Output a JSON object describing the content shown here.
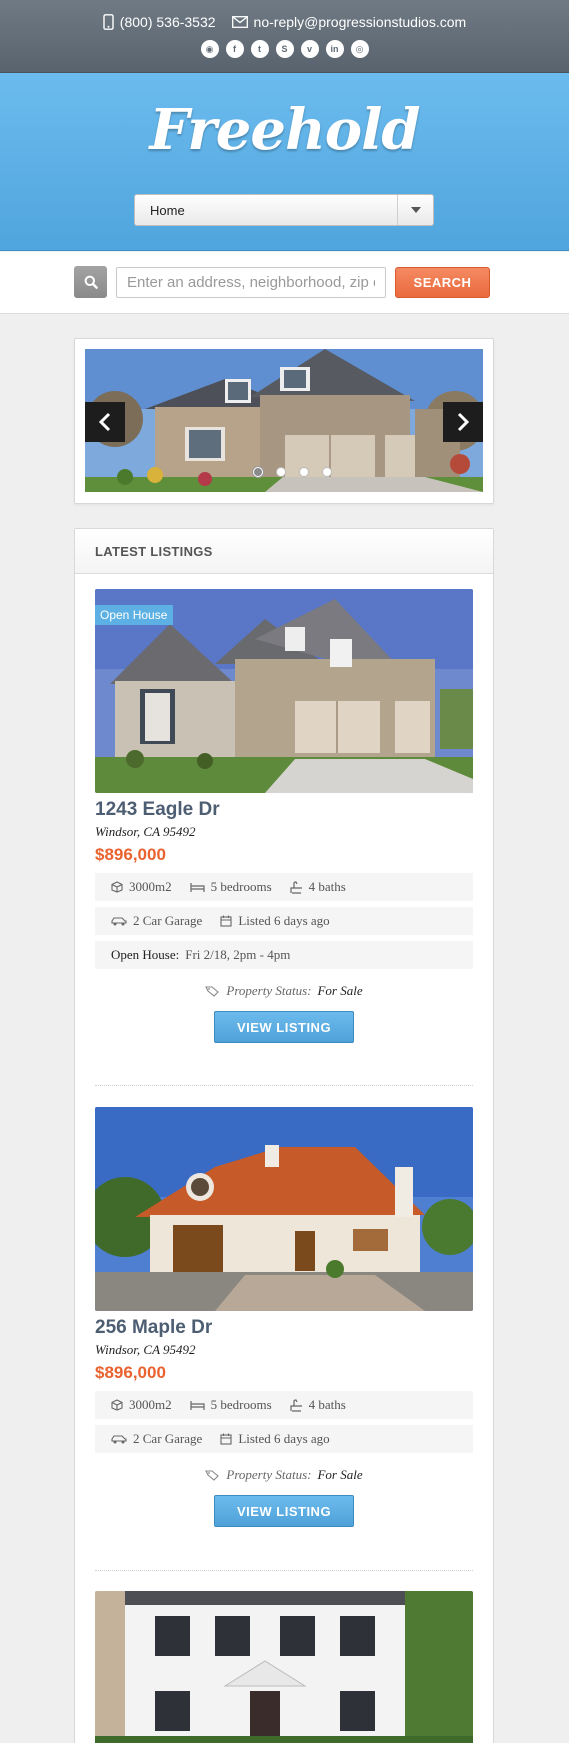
{
  "topbar": {
    "phone": "(800) 536-3532",
    "email": "no-reply@progressionstudios.com",
    "social": [
      {
        "icon": "rss-icon",
        "glyph": "◉"
      },
      {
        "icon": "facebook-icon",
        "glyph": "f"
      },
      {
        "icon": "twitter-icon",
        "glyph": "t"
      },
      {
        "icon": "skype-icon",
        "glyph": "S"
      },
      {
        "icon": "vimeo-icon",
        "glyph": "v"
      },
      {
        "icon": "linkedin-icon",
        "glyph": "in"
      },
      {
        "icon": "dribbble-icon",
        "glyph": "◎"
      }
    ]
  },
  "header": {
    "logo": "Freehold",
    "nav_selected": "Home"
  },
  "search": {
    "placeholder": "Enter an address, neighborhood, zip or",
    "button": "SEARCH"
  },
  "slider": {
    "slides": 4,
    "active_slide": 1
  },
  "listings_section": {
    "title": "LATEST LISTINGS",
    "items": [
      {
        "badge": "Open House",
        "title": "1243 Eagle Dr",
        "city": "Windsor, CA 95492",
        "price": "$896,000",
        "area": "3000m2",
        "bedrooms": "5 bedrooms",
        "baths": "4 baths",
        "garage": "2 Car Garage",
        "listed": "Listed 6 days ago",
        "open_house_label": "Open House:",
        "open_house_time": "Fri 2/18, 2pm - 4pm",
        "status_label": "Property Status:",
        "status_value": "For Sale",
        "button": "VIEW LISTING"
      },
      {
        "title": "256 Maple Dr",
        "city": "Windsor, CA 95492",
        "price": "$896,000",
        "area": "3000m2",
        "bedrooms": "5 bedrooms",
        "baths": "4 baths",
        "garage": "2 Car Garage",
        "listed": "Listed 6 days ago",
        "status_label": "Property Status:",
        "status_value": "For Sale",
        "button": "VIEW LISTING"
      }
    ]
  },
  "colors": {
    "topbar": "#646e78",
    "header_blue": "#5fb1e6",
    "accent_orange": "#e9622f",
    "title_slate": "#4d5e73"
  }
}
